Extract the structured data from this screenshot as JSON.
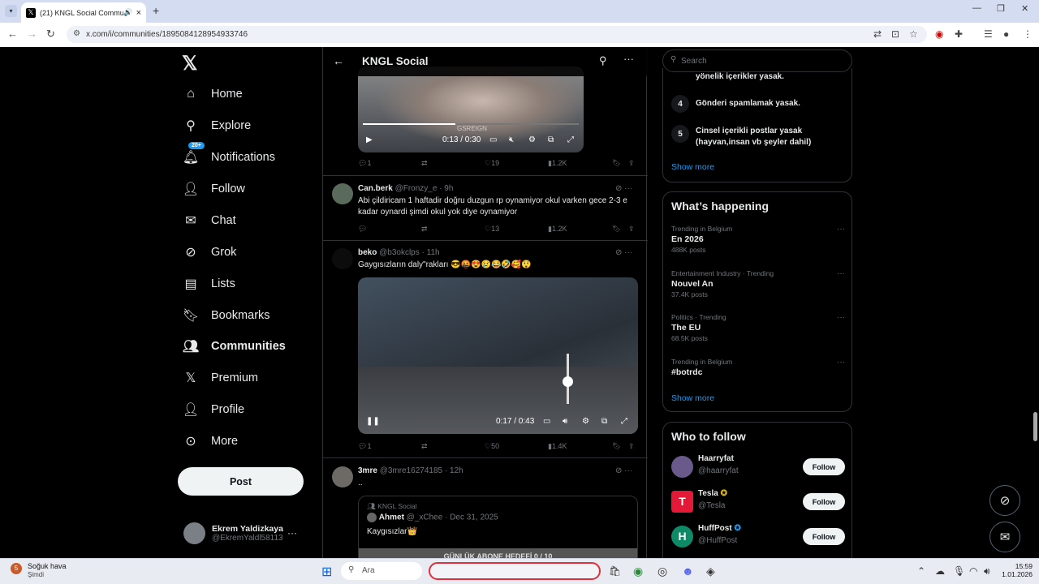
{
  "browser": {
    "tab_title": "(21) KNGL Social Commun",
    "url": "x.com/i/communities/1895084128954933746"
  },
  "nav": {
    "home": "Home",
    "explore": "Explore",
    "notifications": "Notifications",
    "notif_badge": "20+",
    "follow": "Follow",
    "chat": "Chat",
    "grok": "Grok",
    "lists": "Lists",
    "bookmarks": "Bookmarks",
    "communities": "Communities",
    "premium": "Premium",
    "profile": "Profile",
    "more": "More",
    "post": "Post"
  },
  "me": {
    "name": "Ekrem Yaldizkaya",
    "handle": "@EkremYaldl58113"
  },
  "header": {
    "title": "KNGL Social"
  },
  "tweets": [
    {
      "video_time": "0:13 / 0:30",
      "watermark": "GSREIGN",
      "replies": "1",
      "likes": "19",
      "views": "1.2K"
    },
    {
      "name": "Can.berk",
      "handle": "@Fronzy_e",
      "time": "· 9h",
      "text": "Abi çildiricam 1 haftadir doğru duzgun rp oynamiyor okul varken gece 2-3 e kadar oynardi şimdi okul yok diye oynamiyor",
      "likes": "13",
      "views": "1.2K"
    },
    {
      "name": "beko",
      "handle": "@b3okclps",
      "time": "· 11h",
      "text": "Gaygısızların daly\"rakları 😎🤬😍😢😂🤣🥰😲",
      "video_time": "0:17 / 0:43",
      "replies": "1",
      "likes": "50",
      "views": "1.4K"
    },
    {
      "name": "3mre",
      "handle": "@3mre16274185",
      "time": "· 12h",
      "text": "..",
      "quote_community": "KNGL Social",
      "quote_name": "Ahmet",
      "quote_handle": "@_xChee",
      "quote_time": "· Dec 31, 2025",
      "quote_text": "Kaygısızlar👑",
      "quote_overlay": "GÜNLÜK ABONE HEDEFİ 0 / 10"
    }
  ],
  "search": {
    "placeholder": "Search"
  },
  "rules": {
    "partial": "yönelik içerikler yasak.",
    "r4_num": "4",
    "r4": "Gönderi spamlamak yasak.",
    "r5_num": "5",
    "r5": "Cinsel içerikli postlar yasak (hayvan,insan vb şeyler dahil)",
    "show_more": "Show more"
  },
  "happening": {
    "title": "What’s happening",
    "show_more": "Show more",
    "trends": [
      {
        "context": "Trending in Belgium",
        "name": "En 2026",
        "posts": "488K posts"
      },
      {
        "context": "Entertainment Industry · Trending",
        "name": "Nouvel An",
        "posts": "37.4K posts"
      },
      {
        "context": "Politics · Trending",
        "name": "The EU",
        "posts": "68.5K posts"
      },
      {
        "context": "Trending in Belgium",
        "name": "#botrdc",
        "posts": ""
      }
    ]
  },
  "who": {
    "title": "Who to follow",
    "follow_label": "Follow",
    "accounts": [
      {
        "name": "Haarryfat",
        "handle": "@haarryfat"
      },
      {
        "name": "Tesla",
        "handle": "@Tesla"
      },
      {
        "name": "HuffPost",
        "handle": "@HuffPost"
      }
    ]
  },
  "taskbar": {
    "weather_title": "Soğuk hava",
    "weather_sub": "Şimdi",
    "weather_badge": "5",
    "search": "Ara",
    "time": "15:59",
    "date": "1.01.2026"
  },
  "colors": {
    "accent": "#1d9bf0",
    "background": "#000000"
  }
}
